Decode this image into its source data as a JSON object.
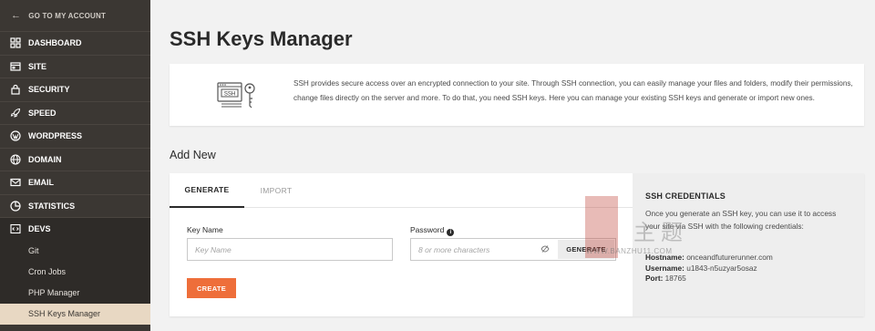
{
  "sidebar": {
    "back_label": "GO TO MY ACCOUNT",
    "items": [
      {
        "label": "DASHBOARD",
        "icon": "dashboard-icon"
      },
      {
        "label": "SITE",
        "icon": "site-icon"
      },
      {
        "label": "SECURITY",
        "icon": "lock-icon"
      },
      {
        "label": "SPEED",
        "icon": "rocket-icon"
      },
      {
        "label": "WORDPRESS",
        "icon": "wordpress-icon"
      },
      {
        "label": "DOMAIN",
        "icon": "globe-icon"
      },
      {
        "label": "EMAIL",
        "icon": "envelope-icon"
      },
      {
        "label": "STATISTICS",
        "icon": "chart-icon"
      },
      {
        "label": "DEVS",
        "icon": "code-icon"
      }
    ],
    "sub_items": [
      "Git",
      "Cron Jobs",
      "PHP Manager",
      "SSH Keys Manager"
    ]
  },
  "page": {
    "title": "SSH Keys Manager",
    "description": "SSH provides secure access over an encrypted connection to your site. Through SSH connection, you can easily manage your files and folders, modify their permissions, change files directly on the server and more. To do that, you need SSH keys. Here you can manage your existing SSH keys and generate or import new ones.",
    "illustration_label": "SSH",
    "add_new_title": "Add New"
  },
  "form": {
    "tabs": [
      "GENERATE",
      "IMPORT"
    ],
    "key_name_label": "Key Name",
    "key_name_placeholder": "Key Name",
    "password_label": "Password",
    "password_placeholder": "8 or more characters",
    "generate_label": "GENERATE",
    "create_label": "CREATE"
  },
  "credentials": {
    "title": "SSH CREDENTIALS",
    "description": "Once you generate an SSH key, you can use it to access your site via SSH with the following credentials:",
    "hostname_label": "Hostname:",
    "hostname_value": "onceandfuturerunner.com",
    "username_label": "Username:",
    "username_value": "u1843-n5uzyar5osaz",
    "port_label": "Port:",
    "port_value": "18765"
  },
  "watermark": {
    "text": "WWW.BANZHU11.COM",
    "cn": "主题"
  },
  "colors": {
    "sidebar_bg": "#3b3733",
    "active_sub_bg": "#e8d8c3",
    "accent": "#ee6e3a"
  }
}
